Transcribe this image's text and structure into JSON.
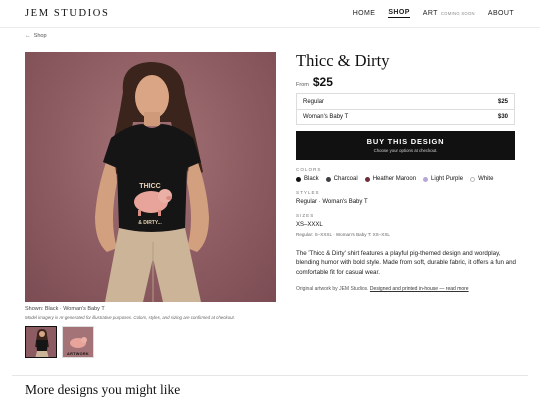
{
  "header": {
    "brand": "JEM STUDIOS",
    "nav": [
      {
        "label": "HOME"
      },
      {
        "label": "SHOP",
        "active": true
      },
      {
        "label": "ART",
        "badge": "COMING SOON"
      },
      {
        "label": "ABOUT"
      }
    ]
  },
  "back": {
    "label": "Shop"
  },
  "gallery": {
    "shirt_graphic_text": [
      "THICC",
      "& DIRTY..."
    ],
    "caption": "Shown: Black · Woman's Baby T",
    "disclaimer": "Model imagery is AI-generated for illustrative purposes. Colors, styles, and sizing are confirmed at checkout.",
    "thumbnails": [
      {
        "label": "",
        "selected": true
      },
      {
        "label": "ARTWORK",
        "selected": false
      }
    ]
  },
  "product": {
    "title": "Thicc & Dirty",
    "price_prefix": "From",
    "price": "$25",
    "options": [
      {
        "name": "Regular",
        "price": "$25"
      },
      {
        "name": "Woman's Baby T",
        "price": "$30"
      }
    ],
    "buy": {
      "label": "BUY THIS DESIGN",
      "sublabel": "Choose your options at checkout."
    },
    "colors_label": "COLORS",
    "colors": [
      {
        "name": "Black",
        "hex": "#111111"
      },
      {
        "name": "Charcoal",
        "hex": "#3d3f44"
      },
      {
        "name": "Heather Maroon",
        "hex": "#6e2f3b"
      },
      {
        "name": "Light Purple",
        "hex": "#b7a7d8"
      },
      {
        "name": "White",
        "hex": "#ffffff"
      }
    ],
    "styles_label": "STYLES",
    "styles": "Regular · Woman's Baby T",
    "sizes_label": "SIZES",
    "sizes": "XS–XXXL",
    "sizes_detail": "Regular: S–XXXL · Woman's Baby T: XS–XXL",
    "description": "The 'Thicc & Dirty' shirt features a playful pig-themed design and wordplay, blending humor with bold style. Made from soft, durable fabric, it offers a fun and comfortable fit for casual wear.",
    "credit_prefix": "Original artwork by JEM Studios.",
    "credit_link": "Designed and printed in-house — read more"
  },
  "more": {
    "title": "More designs you might like"
  }
}
